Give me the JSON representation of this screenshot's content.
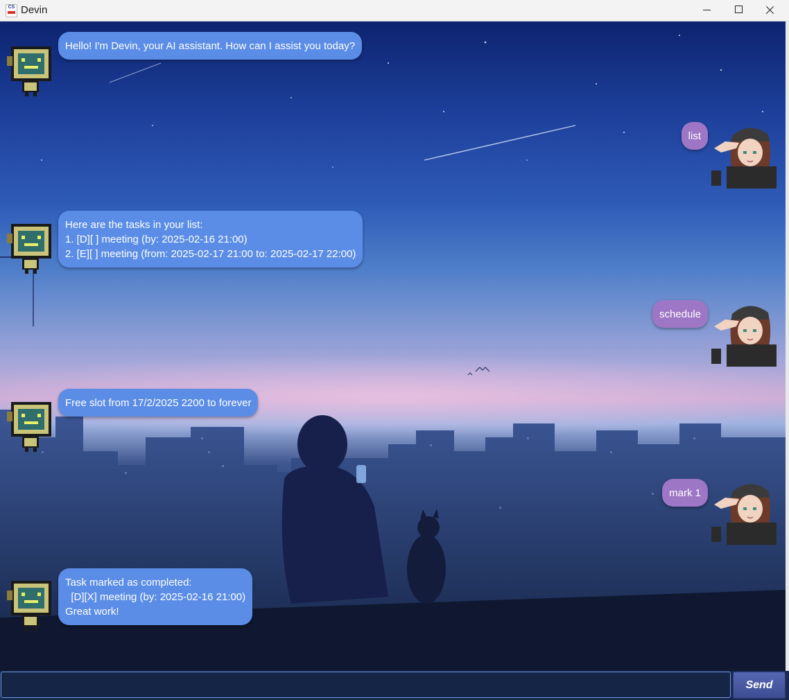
{
  "window": {
    "title": "Devin",
    "icon_text": "CS"
  },
  "chat": {
    "messages": [
      {
        "role": "bot",
        "text": "Hello! I'm Devin, your AI assistant. How can I assist you today?"
      },
      {
        "role": "user",
        "text": "list"
      },
      {
        "role": "bot",
        "text": "Here are the tasks in your list:\n1. [D][ ] meeting (by: 2025-02-16 21:00)\n2. [E][ ] meeting (from: 2025-02-17 21:00 to: 2025-02-17 22:00)"
      },
      {
        "role": "user",
        "text": "schedule"
      },
      {
        "role": "bot",
        "text": "Free slot from 17/2/2025 2200 to forever"
      },
      {
        "role": "user",
        "text": "mark 1"
      },
      {
        "role": "bot",
        "text": "Task marked as completed:\n  [D][X] meeting (by: 2025-02-16 21:00)\nGreat work!"
      }
    ]
  },
  "input": {
    "value": "",
    "send_label": "Send"
  },
  "colors": {
    "bot_bubble": "#5b8de6",
    "user_bubble": "#9d76c6",
    "send_button": "#4a5aa3"
  },
  "icons": {
    "bot_avatar": "robot-avatar-icon",
    "user_avatar": "girl-avatar-icon"
  }
}
